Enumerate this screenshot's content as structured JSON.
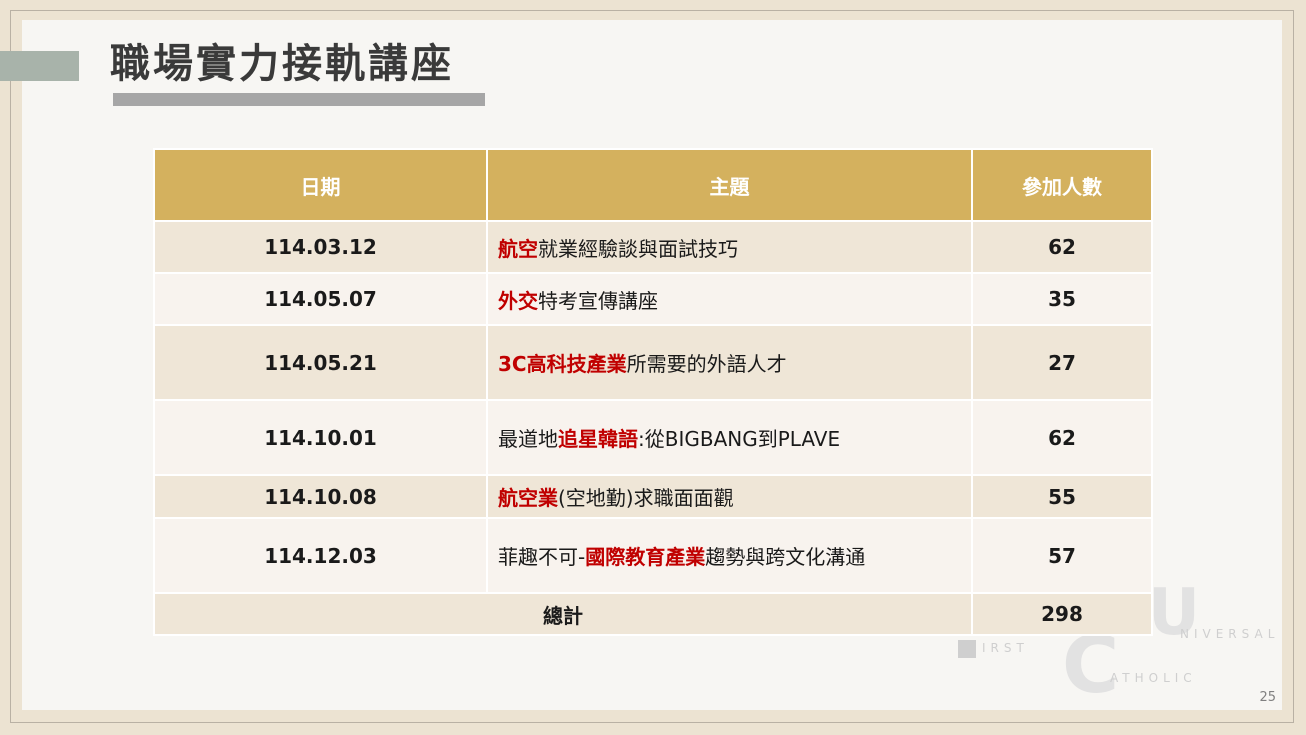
{
  "slide": {
    "title": "職場實力接軌講座",
    "page_number": "25"
  },
  "table": {
    "headers": [
      "日期",
      "主題",
      "參加人數"
    ],
    "rows": [
      {
        "date": "114.03.12",
        "topic": [
          {
            "t": "航空",
            "hl": true
          },
          {
            "t": "就業經驗談與面試技巧",
            "hl": false
          }
        ],
        "count": "62"
      },
      {
        "date": "114.05.07",
        "topic": [
          {
            "t": "外交",
            "hl": true
          },
          {
            "t": "特考宣傳講座",
            "hl": false
          }
        ],
        "count": "35"
      },
      {
        "date": "114.05.21",
        "topic": [
          {
            "t": "3C高科技產業",
            "hl": true
          },
          {
            "t": "所需要的外語人才",
            "hl": false
          }
        ],
        "count": "27"
      },
      {
        "date": "114.10.01",
        "topic": [
          {
            "t": "最道地",
            "hl": false
          },
          {
            "t": "追星韓語",
            "hl": true
          },
          {
            "t": ":從BIGBANG到PLAVE",
            "hl": false
          }
        ],
        "count": "62"
      },
      {
        "date": "114.10.08",
        "topic": [
          {
            "t": "航空業",
            "hl": true
          },
          {
            "t": "(空地勤)求職面面觀",
            "hl": false
          }
        ],
        "count": "55"
      },
      {
        "date": "114.12.03",
        "topic": [
          {
            "t": "菲趣不可-",
            "hl": false
          },
          {
            "t": "國際教育產業",
            "hl": true
          },
          {
            "t": "趨勢與跨文化溝通",
            "hl": false
          }
        ],
        "count": "57"
      }
    ],
    "total_label": "總計",
    "total_value": "298"
  },
  "watermark": {
    "letters": [
      "C",
      "U"
    ],
    "words": [
      "IRST",
      "NIVERSAL",
      "ATHOLIC"
    ]
  },
  "colors": {
    "header_bg": "#d4b15e",
    "row_a": "#efe6d7",
    "row_b": "#f8f3ee",
    "highlight": "#c00000",
    "accent_bar": "#a8b3aa"
  }
}
